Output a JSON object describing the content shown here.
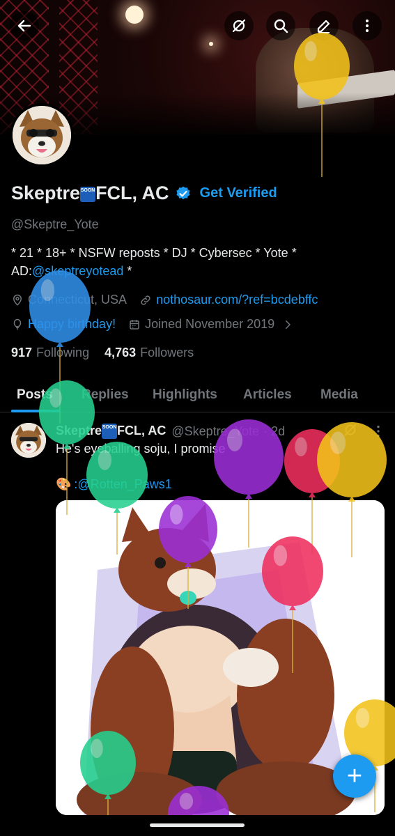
{
  "profile": {
    "display_name_part1": "Skeptre",
    "soon_emoji": "SOON",
    "display_name_part2": "FCL, AC",
    "get_verified": "Get Verified",
    "handle": "@Skeptre_Yote",
    "bio_line1": "* 21 * 18+  * NSFW reposts * DJ * Cybersec * Yote *",
    "bio_line2_prefix": "AD:",
    "bio_link": "@skeptreyotead",
    "bio_line2_suffix": " *",
    "location": "Connecticut, USA",
    "website": "nothosaur.com/?ref=bcdebffc",
    "birthday": "Happy birthday!",
    "joined": "Joined November 2019",
    "following_count": "917",
    "following_label": "Following",
    "followers_count": "4,763",
    "followers_label": "Followers"
  },
  "tabs": [
    {
      "label": "Posts",
      "active": true
    },
    {
      "label": "Replies"
    },
    {
      "label": "Highlights"
    },
    {
      "label": "Articles"
    },
    {
      "label": "Media"
    }
  ],
  "post": {
    "author_part1": "Skeptre",
    "author_part2": "FCL, AC",
    "handle": "@Skeptre_Yote",
    "time": "· 2d",
    "text": "He's eyeballing soju, I promise",
    "credit_emoji": "🎨",
    "credit_text": ":@Rotten_Paws1"
  },
  "colors": {
    "accent": "#1d9bf0",
    "balloon_yellow": "#f2c21a",
    "balloon_blue": "#2f8fe8",
    "balloon_green": "#25d08f",
    "balloon_purple": "#9b2ed6",
    "balloon_pink": "#ee2f5e"
  },
  "icons": [
    "back-arrow-icon",
    "grok-icon",
    "search-icon",
    "edit-icon",
    "more-vertical-icon",
    "verified-badge-icon",
    "location-icon",
    "link-icon",
    "balloon-icon",
    "calendar-icon",
    "chevron-right-icon",
    "plus-icon"
  ]
}
